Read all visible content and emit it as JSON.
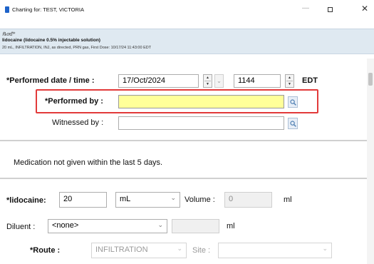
{
  "window": {
    "title": "Charting for: TEST, VICTORIA",
    "minimize": "—",
    "close": "✕"
  },
  "order": {
    "rx_symbol": "℞ơđ*",
    "name": "lidocaine (lidocaine 0.5% injectable solution)",
    "details": "20 mL, INFILTRATION, INJ, as directed, PRN gas, First Dose: 10/17/24 11:43:00 EDT"
  },
  "form": {
    "performed_datetime": {
      "label": "*Performed date / time :",
      "date_value": "17/Oct/2024",
      "time_value": "1144",
      "timezone": "EDT"
    },
    "performed_by": {
      "label": "*Performed by :",
      "value": ""
    },
    "witnessed_by": {
      "label": "Witnessed by :",
      "value": ""
    },
    "notice": "Medication not given within the last 5 days.",
    "lidocaine": {
      "label": "*lidocaine:",
      "dose_value": "20",
      "unit_value": "mL",
      "volume_label": "Volume :",
      "volume_value": "0",
      "volume_unit": "ml"
    },
    "diluent": {
      "label": "Diluent :",
      "value": "<none>",
      "volume_unit": "ml"
    },
    "route": {
      "label": "*Route :",
      "value": "INFILTRATION",
      "site_label": "Site :",
      "site_value": ""
    }
  },
  "colors": {
    "required_highlight": "#e23a3a",
    "active_field": "#ffff99",
    "header_band": "#dfe9f1"
  },
  "icons": {
    "lookup": "magnifier-icon",
    "spin": "spin-up-down-icon",
    "dropdown": "chevron-down-icon"
  }
}
